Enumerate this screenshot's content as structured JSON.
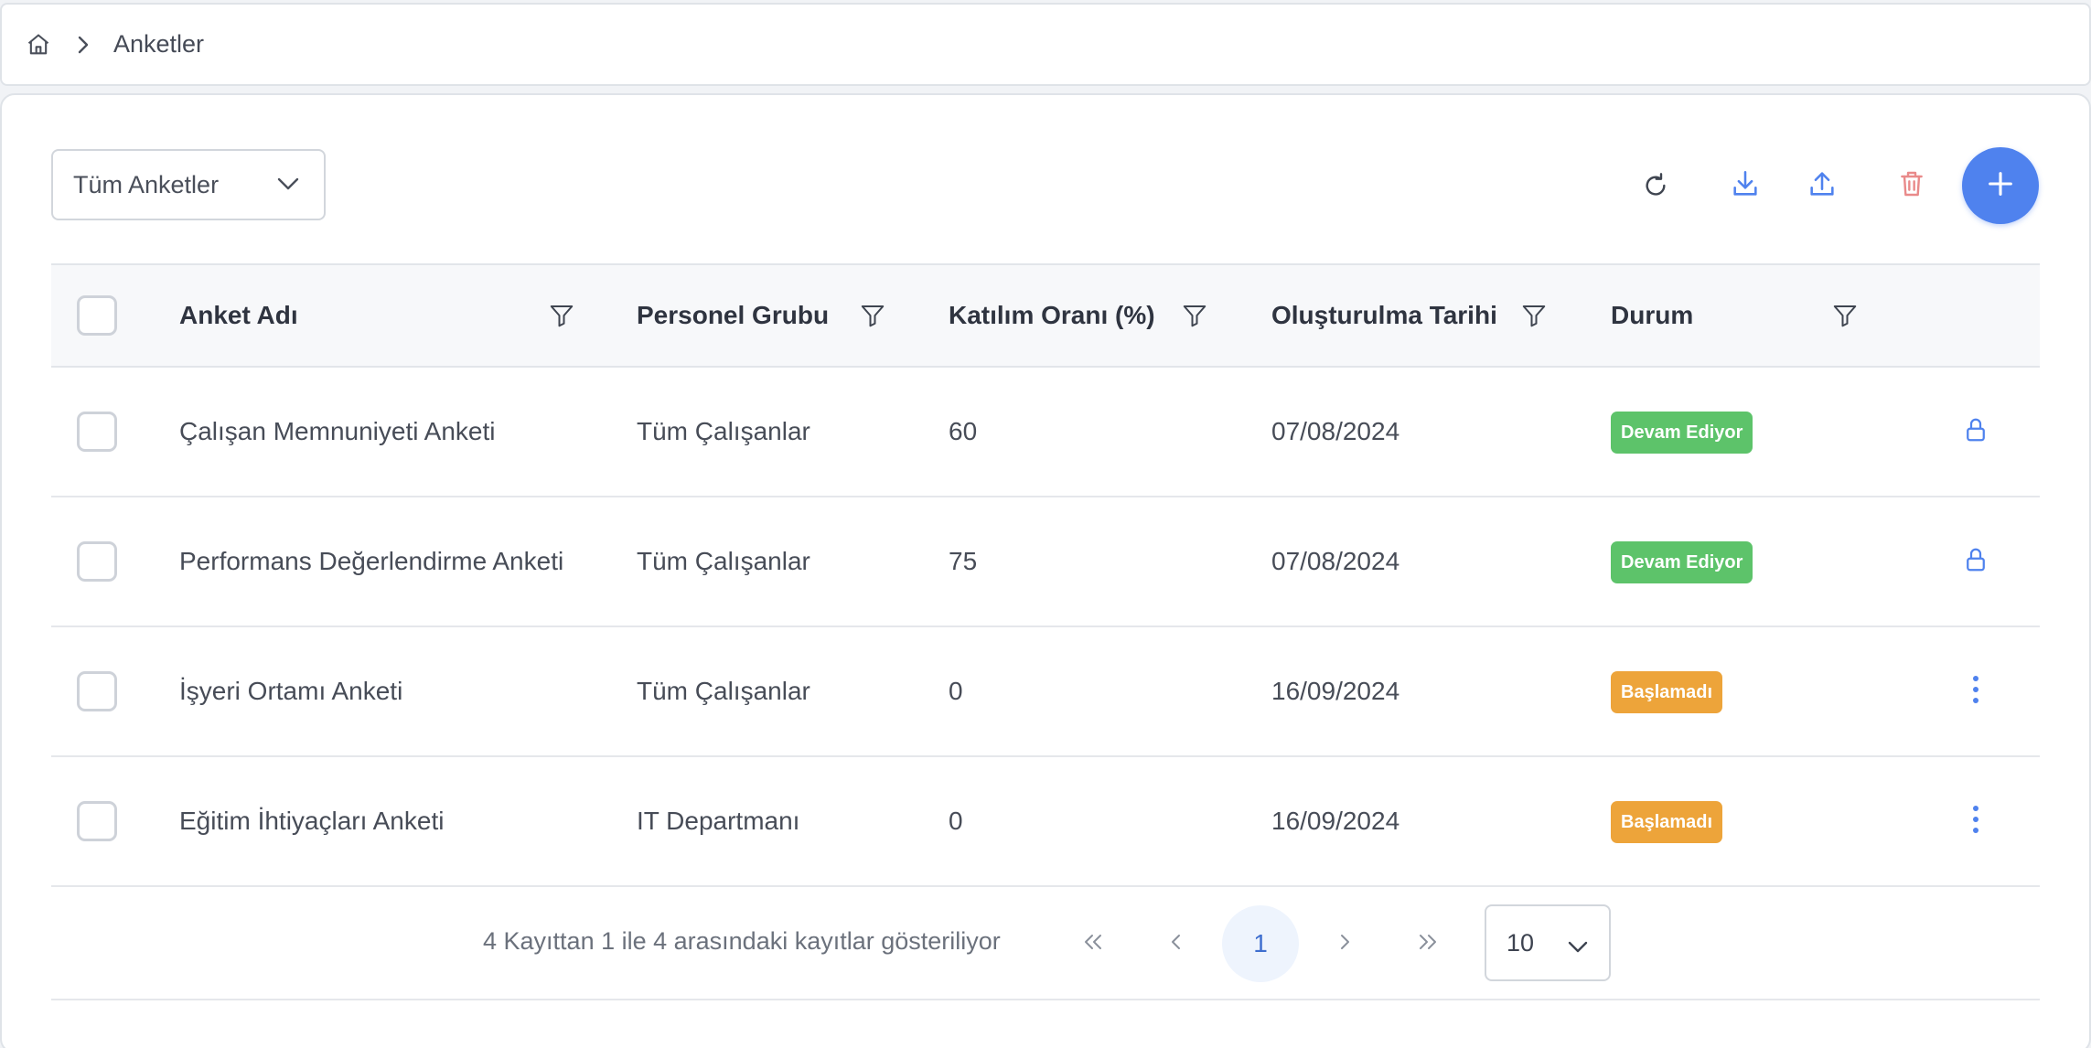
{
  "breadcrumb": {
    "home_icon": "home-icon",
    "separator_icon": "chevron-right-icon",
    "current": "Anketler"
  },
  "filter_select": {
    "selected": "Tüm Anketler",
    "icon": "chevron-down-icon"
  },
  "toolbar": {
    "refresh_icon": "refresh-icon",
    "download_icon": "download-icon",
    "upload_icon": "upload-icon",
    "delete_icon": "trash-icon",
    "add_icon": "plus-icon"
  },
  "table": {
    "columns": [
      {
        "label": "Anket Adı"
      },
      {
        "label": "Personel Grubu"
      },
      {
        "label": "Katılım Oranı (%)"
      },
      {
        "label": "Oluşturulma Tarihi"
      },
      {
        "label": "Durum"
      }
    ],
    "rows": [
      {
        "name": "Çalışan Memnuniyeti Anketi",
        "group": "Tüm Çalışanlar",
        "rate": "60",
        "date": "07/08/2024",
        "status": "Devam Ediyor",
        "action_icon": "lock-icon"
      },
      {
        "name": "Performans Değerlendirme Anketi",
        "group": "Tüm Çalışanlar",
        "rate": "75",
        "date": "07/08/2024",
        "status": "Devam Ediyor",
        "action_icon": "lock-icon"
      },
      {
        "name": "İşyeri Ortamı Anketi",
        "group": "Tüm Çalışanlar",
        "rate": "0",
        "date": "16/09/2024",
        "status": "Başlamadı",
        "action_icon": "more-vertical-icon"
      },
      {
        "name": "Eğitim İhtiyaçları Anketi",
        "group": "IT Departmanı",
        "rate": "0",
        "date": "16/09/2024",
        "status": "Başlamadı",
        "action_icon": "more-vertical-icon"
      }
    ]
  },
  "pagination": {
    "info": "4 Kayıttan 1 ile 4 arasındaki kayıtlar gösteriliyor",
    "current_page": "1",
    "per_page": "10"
  },
  "colors": {
    "accent": "#4f82ee",
    "status_in_progress": "#5dc36a",
    "status_not_started": "#eda43a",
    "delete": "#e98a8a"
  }
}
